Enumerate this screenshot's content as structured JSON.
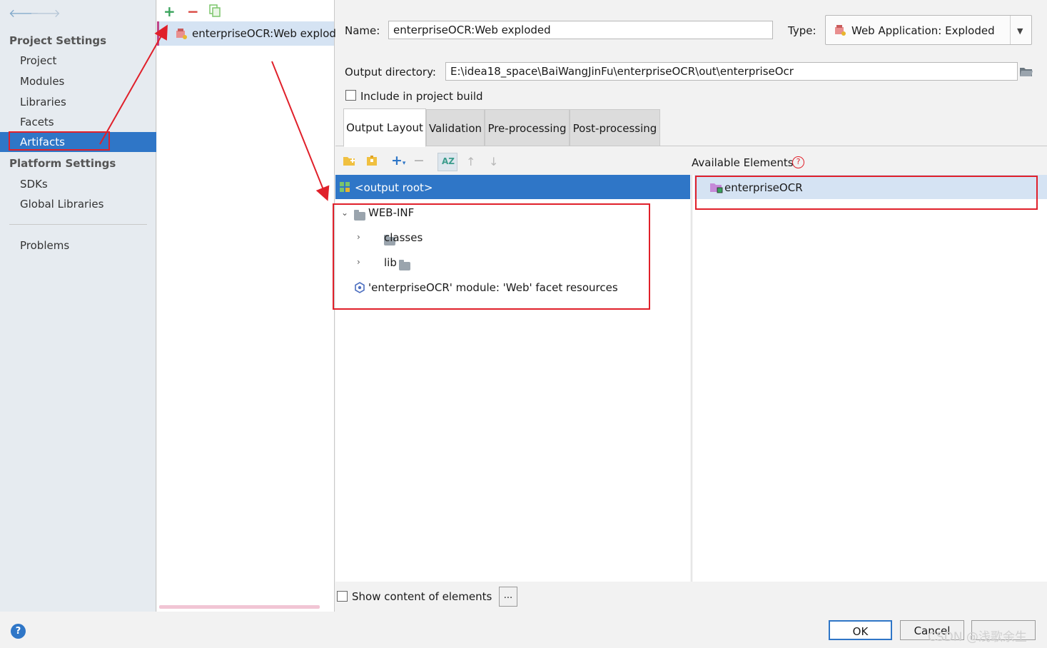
{
  "nav": {
    "section_project": "Project Settings",
    "project_items": [
      "Project",
      "Modules",
      "Libraries",
      "Facets",
      "Artifacts"
    ],
    "section_platform": "Platform Settings",
    "platform_items": [
      "SDKs",
      "Global Libraries"
    ],
    "problems": "Problems"
  },
  "artifacts_list": {
    "selected": "enterpriseOCR:Web exploded"
  },
  "form": {
    "name_label": "Name:",
    "name_value": "enterpriseOCR:Web exploded",
    "type_label": "Type:",
    "type_value": "Web Application: Exploded",
    "output_dir_label": "Output directory:",
    "output_dir_value": "E:\\idea18_space\\BaiWangJinFu\\enterpriseOCR\\out\\enterpriseOcr",
    "include_label": "Include in project build"
  },
  "tabs": [
    "Output Layout",
    "Validation",
    "Pre-processing",
    "Post-processing"
  ],
  "layout_tree": {
    "root": "<output root>",
    "web_inf": "WEB-INF",
    "classes": "classes",
    "lib": "lib",
    "facet": "'enterpriseOCR' module: 'Web' facet resources"
  },
  "available": {
    "title": "Available Elements",
    "item": "enterpriseOCR"
  },
  "bottom": {
    "show_content_label": "Show content of elements",
    "ellipsis": "..."
  },
  "footer": {
    "ok": "OK",
    "cancel": "Cancel",
    "watermark": "CSDN @浅歌余生"
  },
  "colors": {
    "selection": "#2f76c7",
    "annotation": "#e0202a"
  }
}
